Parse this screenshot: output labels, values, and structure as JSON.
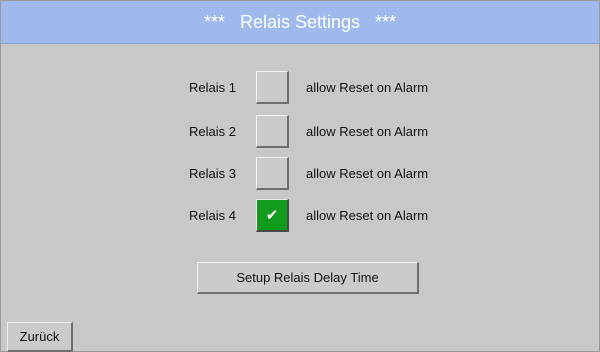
{
  "header": {
    "stars_left": "***",
    "title": "Relais Settings",
    "stars_right": "***"
  },
  "relays": [
    {
      "label": "Relais 1",
      "option": "allow Reset on Alarm",
      "checked": false
    },
    {
      "label": "Relais 2",
      "option": "allow Reset on Alarm",
      "checked": false
    },
    {
      "label": "Relais 3",
      "option": "allow Reset on Alarm",
      "checked": false
    },
    {
      "label": "Relais 4",
      "option": "allow Reset on Alarm",
      "checked": true
    }
  ],
  "check_glyph": "✔",
  "delay_button_label": "Setup Relais Delay Time",
  "back_button_label": "Zurück",
  "colors": {
    "header_bg": "#9fb9ec",
    "screen_bg": "#c8c8c8",
    "checked_bg": "#139b1e"
  }
}
